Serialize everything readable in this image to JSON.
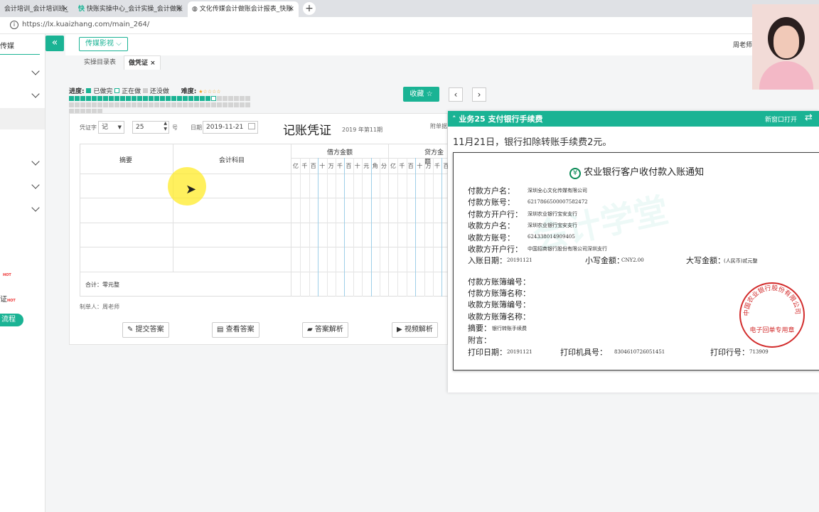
{
  "browser": {
    "tabs": [
      {
        "label": "会计培训_会计培训班_",
        "active": false
      },
      {
        "label": "快账实操中心_会计实操_会计做账",
        "active": false
      },
      {
        "label": "文化传媒会计做账会计报表_快账",
        "active": true
      }
    ],
    "new_tab": "+",
    "tab_close": "×",
    "url": "https://lx.kuaizhang.com/main_264/"
  },
  "sidebar": {
    "title": "传媒",
    "items": [
      "",
      "",
      "",
      "",
      ""
    ],
    "hot_badge": "HOT",
    "item_voucher": "证",
    "flow_button": "流程"
  },
  "header": {
    "collapse": "«",
    "company_dropdown": "传媒影视",
    "teacher": "周老师"
  },
  "subtabs": {
    "tab1": "实操目录表",
    "tab2": "做凭证",
    "close": "×"
  },
  "progress": {
    "label": "进度:",
    "done": "已做完",
    "doing": "正在做",
    "todo": "还没做",
    "difficulty_label": "难度:",
    "cells_done": 25,
    "cells_current": 1,
    "cells_total": 70
  },
  "actions": {
    "favorite": "收藏",
    "prev": "‹",
    "next": "›"
  },
  "voucher": {
    "type_label": "凭证字",
    "type_value": "记",
    "number_value": "25",
    "number_unit": "号",
    "date_label": "日期",
    "date_value": "2019-11-21",
    "title": "记账凭证",
    "period": "2019 年第11期",
    "attach_label": "附单据",
    "col_summary": "摘要",
    "col_subject": "会计科目",
    "col_debit": "借方金额",
    "col_credit": "贷方金额",
    "digits": [
      "亿",
      "千",
      "百",
      "十",
      "万",
      "千",
      "百",
      "十",
      "元",
      "角",
      "分"
    ],
    "total_label": "合计：零元整",
    "maker": "制单人：周老师",
    "btn_submit": "提交答案",
    "btn_view": "查看答案",
    "btn_analysis": "答案解析",
    "btn_video": "视频解析"
  },
  "task": {
    "title": "业务25 支付银行手续费",
    "open_new": "新窗口打开",
    "description": "11月21日，银行扣除转账手续费2元。"
  },
  "receipt": {
    "bank_title": "农业银行客户收付款入账通知",
    "payer_name_label": "付款方户名：",
    "payer_name": "深圳全心文化传媒有限公司",
    "payer_account_label": "付款方账号：",
    "payer_account": "6217866500007582472",
    "payer_bank_label": "付款方开户行：",
    "payer_bank": "深圳农业银行宝安支行",
    "payee_name_label": "收款方户名：",
    "payee_name": "深圳农业银行宝安支行",
    "payee_account_label": "收款方账号：",
    "payee_account": "624338014909405",
    "payee_bank_label": "收款方开户行：",
    "payee_bank": "中国招商银行股份有限公司深圳支行",
    "date_label": "入账日期：",
    "date": "20191121",
    "small_amount_label": "小写金额：",
    "small_amount": "CNY2.00",
    "big_amount_label": "大写金额：",
    "big_amount": "(人民币)贰元整",
    "payer_book_no": "付款方账簿编号：",
    "payer_book_name": "付款方账簿名称：",
    "payee_book_no": "收款方账簿编号：",
    "payee_book_name": "收款方账簿名称：",
    "memo_label": "摘要：",
    "memo": "银行转账手续费",
    "note_label": "附言：",
    "print_date_label": "打印日期：",
    "print_date": "20191121",
    "machine_label": "打印机具号：",
    "machine": "8304610726051451",
    "print_no_label": "打印行号：",
    "print_no": "713909",
    "stamp_outer": "中国农业银行股份有限公司",
    "stamp_inner": "电子回单专用章",
    "watermark": "会计学堂"
  },
  "colors": {
    "accent": "#1ab394",
    "stamp": "#d22b2b",
    "bank_green": "#0a8a56"
  }
}
